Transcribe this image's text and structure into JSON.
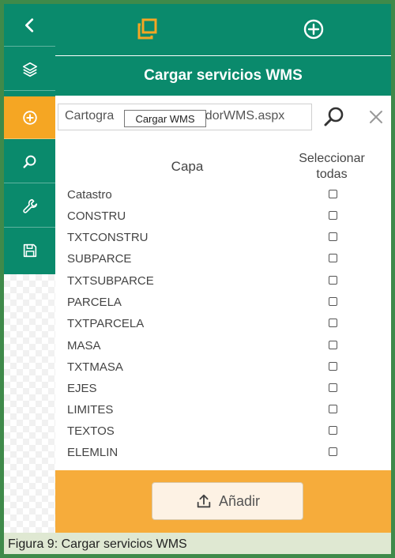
{
  "sidebar": {
    "items": [
      {
        "icon": "chevron-left-icon"
      },
      {
        "icon": "layers-icon"
      },
      {
        "icon": "plus-circle-icon",
        "active": true
      },
      {
        "icon": "search-icon"
      },
      {
        "icon": "wrench-icon"
      },
      {
        "icon": "save-icon"
      }
    ]
  },
  "topbar": {
    "icons": [
      "copy-icon",
      "plus-circle-icon"
    ]
  },
  "header": {
    "title": "Cargar servicios WMS"
  },
  "url_bar": {
    "value": "Cartogra",
    "value_suffix": "vidorWMS.aspx",
    "tooltip": "Cargar WMS"
  },
  "table": {
    "headers": {
      "layer": "Capa",
      "select_all_line1": "Seleccionar",
      "select_all_line2": "todas"
    },
    "rows": [
      {
        "name": "Catastro",
        "checked": false
      },
      {
        "name": "CONSTRU",
        "checked": false
      },
      {
        "name": "TXTCONSTRU",
        "checked": false
      },
      {
        "name": "SUBPARCE",
        "checked": false
      },
      {
        "name": "TXTSUBPARCE",
        "checked": false
      },
      {
        "name": "PARCELA",
        "checked": false
      },
      {
        "name": "TXTPARCELA",
        "checked": false
      },
      {
        "name": "MASA",
        "checked": false
      },
      {
        "name": "TXTMASA",
        "checked": false
      },
      {
        "name": "EJES",
        "checked": false
      },
      {
        "name": "LIMITES",
        "checked": false
      },
      {
        "name": "TEXTOS",
        "checked": false
      },
      {
        "name": "ELEMLIN",
        "checked": false
      }
    ]
  },
  "footer": {
    "add_label": "Añadir"
  },
  "caption": "Figura 9: Cargar servicios WMS",
  "colors": {
    "green": "#0a8a6c",
    "orange": "#f5a623",
    "frame": "#3f8a4a"
  }
}
